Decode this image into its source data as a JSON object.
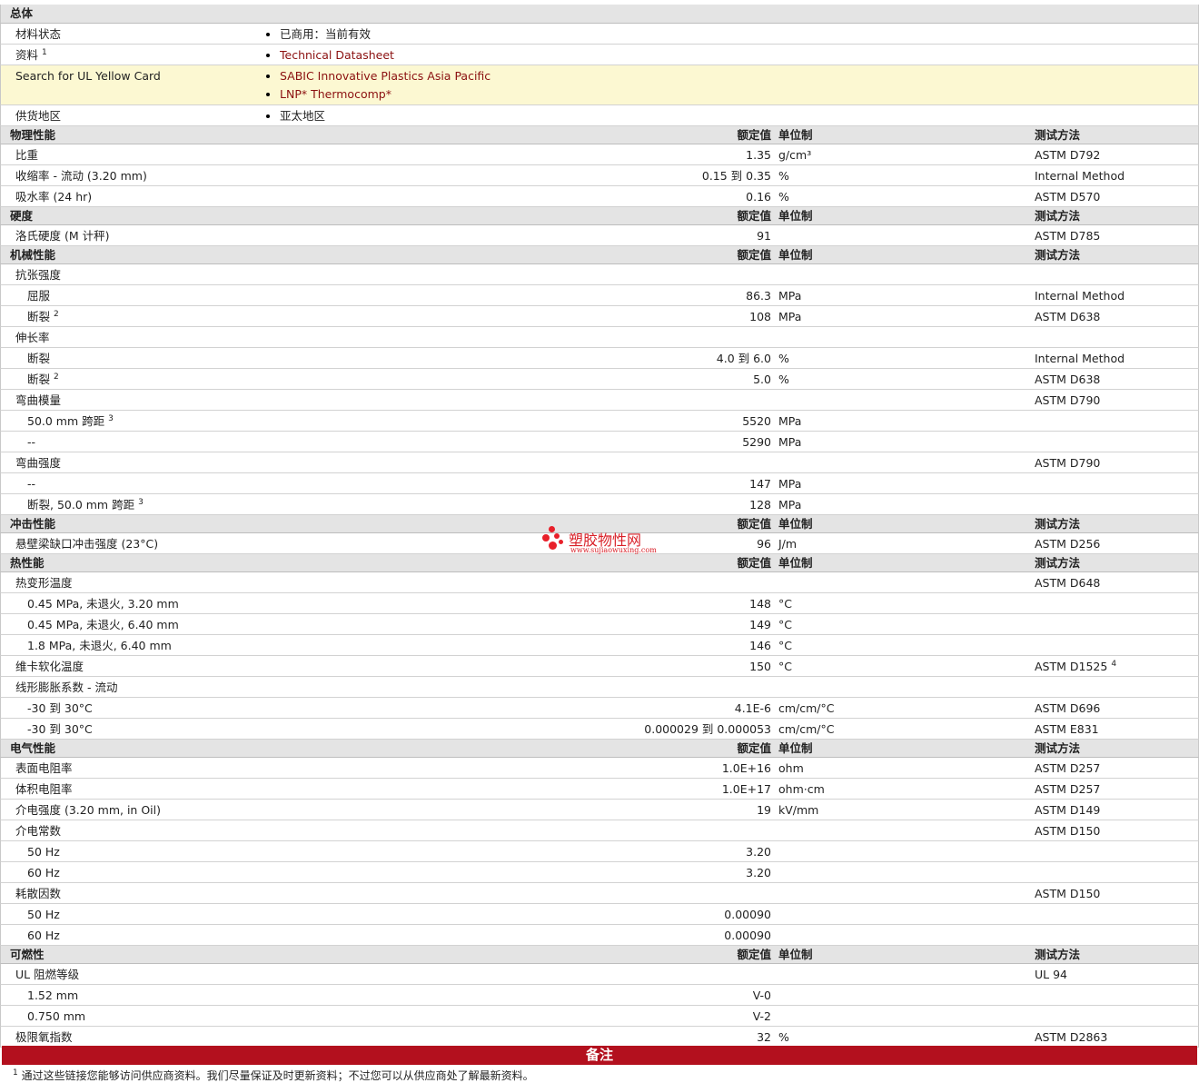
{
  "general": {
    "title": "总体",
    "rows": [
      {
        "label": "材料状态",
        "sup": "",
        "items": [
          "已商用：当前有效"
        ],
        "links": false
      },
      {
        "label": "资料",
        "sup": "1",
        "items": [
          "Technical Datasheet"
        ],
        "links": true
      },
      {
        "label": "Search for UL Yellow Card",
        "sup": "",
        "items": [
          "SABIC Innovative Plastics Asia Pacific",
          "LNP* Thermocomp*"
        ],
        "links": true
      },
      {
        "label": "供货地区",
        "sup": "",
        "items": [
          "亚太地区"
        ],
        "links": false
      }
    ]
  },
  "headers": {
    "value": "额定值",
    "unit": "单位制",
    "method": "测试方法"
  },
  "sections": [
    {
      "title": "物理性能",
      "rows": [
        {
          "label": "比重",
          "indent": 0,
          "value": "1.35",
          "unit": "g/cm³",
          "method": "ASTM D792"
        },
        {
          "label": "收缩率  - 流动  (3.20 mm)",
          "indent": 0,
          "value": "0.15 到  0.35",
          "unit": "%",
          "method": "Internal Method"
        },
        {
          "label": "吸水率  (24 hr)",
          "indent": 0,
          "value": "0.16",
          "unit": "%",
          "method": "ASTM D570"
        }
      ]
    },
    {
      "title": "硬度",
      "rows": [
        {
          "label": "洛氏硬度  (M 计秤)",
          "indent": 0,
          "value": "91",
          "unit": "",
          "method": "ASTM D785"
        }
      ]
    },
    {
      "title": "机械性能",
      "rows": [
        {
          "label": "抗张强度",
          "indent": 0,
          "value": "",
          "unit": "",
          "method": ""
        },
        {
          "label": "屈服",
          "indent": 1,
          "value": "86.3",
          "unit": "MPa",
          "method": "Internal Method"
        },
        {
          "label": "断裂",
          "sup": "2",
          "indent": 1,
          "value": "108",
          "unit": "MPa",
          "method": "ASTM D638"
        },
        {
          "label": "伸长率",
          "indent": 0,
          "value": "",
          "unit": "",
          "method": ""
        },
        {
          "label": "断裂",
          "indent": 1,
          "value": "4.0 到  6.0",
          "unit": "%",
          "method": "Internal Method"
        },
        {
          "label": "断裂",
          "sup": "2",
          "indent": 1,
          "value": "5.0",
          "unit": "%",
          "method": "ASTM D638"
        },
        {
          "label": "弯曲模量",
          "indent": 0,
          "value": "",
          "unit": "",
          "method": "ASTM D790"
        },
        {
          "label": "50.0 mm 跨距",
          "sup": "3",
          "indent": 1,
          "value": "5520",
          "unit": "MPa",
          "method": ""
        },
        {
          "label": "--",
          "indent": 1,
          "value": "5290",
          "unit": "MPa",
          "method": ""
        },
        {
          "label": "弯曲强度",
          "indent": 0,
          "value": "",
          "unit": "",
          "method": "ASTM D790"
        },
        {
          "label": "--",
          "indent": 1,
          "value": "147",
          "unit": "MPa",
          "method": ""
        },
        {
          "label": "断裂, 50.0 mm 跨距",
          "sup": "3",
          "indent": 1,
          "value": "128",
          "unit": "MPa",
          "method": ""
        }
      ]
    },
    {
      "title": "冲击性能",
      "rows": [
        {
          "label": "悬壁梁缺口冲击强度  (23°C)",
          "indent": 0,
          "value": "96",
          "unit": "J/m",
          "method": "ASTM D256"
        }
      ]
    },
    {
      "title": "热性能",
      "rows": [
        {
          "label": "热变形温度",
          "indent": 0,
          "value": "",
          "unit": "",
          "method": "ASTM D648"
        },
        {
          "label": "0.45 MPa, 未退火, 3.20 mm",
          "indent": 1,
          "value": "148",
          "unit": "°C",
          "method": ""
        },
        {
          "label": "0.45 MPa, 未退火, 6.40 mm",
          "indent": 1,
          "value": "149",
          "unit": "°C",
          "method": ""
        },
        {
          "label": "1.8 MPa, 未退火, 6.40 mm",
          "indent": 1,
          "value": "146",
          "unit": "°C",
          "method": ""
        },
        {
          "label": "维卡软化温度",
          "indent": 0,
          "value": "150",
          "unit": "°C",
          "method": "ASTM D1525",
          "method_sup": "4"
        },
        {
          "label": "线形膨胀系数  - 流动",
          "indent": 0,
          "value": "",
          "unit": "",
          "method": ""
        },
        {
          "label": "-30 到  30°C",
          "indent": 1,
          "value": "4.1E-6",
          "unit": "cm/cm/°C",
          "method": "ASTM D696"
        },
        {
          "label": "-30 到  30°C",
          "indent": 1,
          "value": "0.000029 到  0.000053",
          "unit": "cm/cm/°C",
          "method": "ASTM E831"
        }
      ]
    },
    {
      "title": "电气性能",
      "rows": [
        {
          "label": "表面电阻率",
          "indent": 0,
          "value": "1.0E+16",
          "unit": "ohm",
          "method": "ASTM D257"
        },
        {
          "label": "体积电阻率",
          "indent": 0,
          "value": "1.0E+17",
          "unit": "ohm·cm",
          "method": "ASTM D257"
        },
        {
          "label": "介电强度  (3.20 mm, in Oil)",
          "indent": 0,
          "value": "19",
          "unit": "kV/mm",
          "method": "ASTM D149"
        },
        {
          "label": "介电常数",
          "indent": 0,
          "value": "",
          "unit": "",
          "method": "ASTM D150"
        },
        {
          "label": "50 Hz",
          "indent": 1,
          "value": "3.20",
          "unit": "",
          "method": ""
        },
        {
          "label": "60 Hz",
          "indent": 1,
          "value": "3.20",
          "unit": "",
          "method": ""
        },
        {
          "label": "耗散因数",
          "indent": 0,
          "value": "",
          "unit": "",
          "method": "ASTM D150"
        },
        {
          "label": "50 Hz",
          "indent": 1,
          "value": "0.00090",
          "unit": "",
          "method": ""
        },
        {
          "label": "60 Hz",
          "indent": 1,
          "value": "0.00090",
          "unit": "",
          "method": ""
        }
      ]
    },
    {
      "title": "可燃性",
      "rows": [
        {
          "label": "UL 阻燃等级",
          "indent": 0,
          "value": "",
          "unit": "",
          "method": "UL 94"
        },
        {
          "label": "1.52 mm",
          "indent": 1,
          "value": "V-0",
          "unit": "",
          "method": ""
        },
        {
          "label": "0.750 mm",
          "indent": 1,
          "value": "V-2",
          "unit": "",
          "method": ""
        },
        {
          "label": "极限氧指数",
          "indent": 0,
          "value": "32",
          "unit": "%",
          "method": "ASTM D2863"
        }
      ]
    }
  ],
  "notes": {
    "title": "备注",
    "footnote_num": "1",
    "footnote_text": "通过这些链接您能够访问供应商资料。我们尽量保证及时更新资料；不过您可以从供应商处了解最新资料。"
  },
  "watermark": {
    "text": "塑胶物性网",
    "url": "www.sujiaowuxing.com"
  },
  "colors": {
    "header_bg": "#e4e4e4",
    "highlight_bg": "#fcf8d2",
    "link": "#8b1010",
    "notes_bar": "#b3101e",
    "watermark": "#d92028"
  }
}
